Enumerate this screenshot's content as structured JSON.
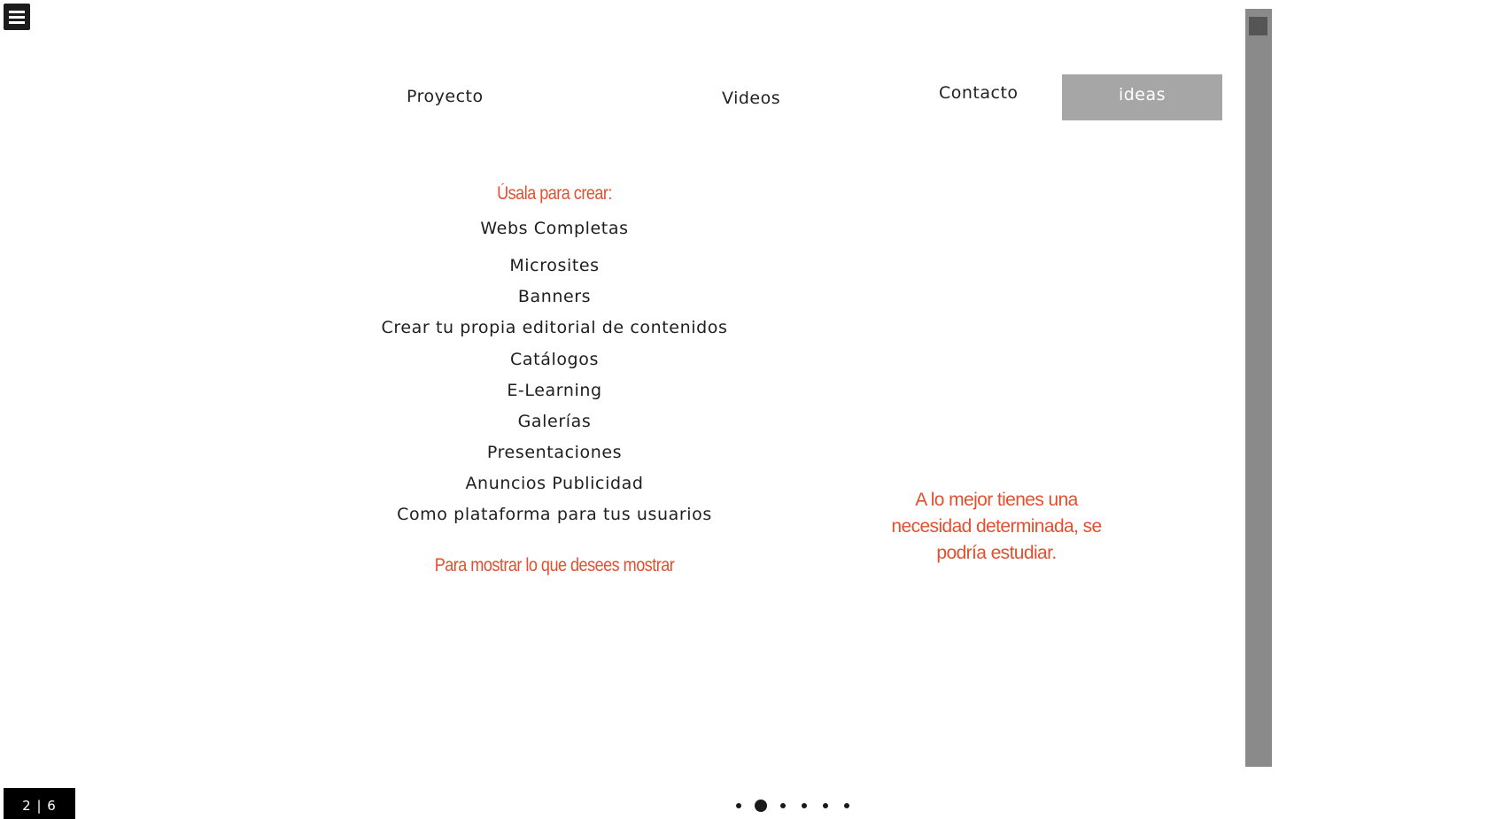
{
  "nav": {
    "proyecto": "Proyecto",
    "videos": "Videos",
    "contacto": "Contacto",
    "ideas": "ideas"
  },
  "list": {
    "heading": "Úsala para crear:",
    "items": [
      "Webs Completas",
      "Microsites",
      "Banners",
      "Crear tu propia editorial de contenidos",
      "Catálogos",
      "E-Learning",
      "Galerías",
      "Presentaciones",
      "Anuncios Publicidad",
      "Como plataforma para tus usuarios"
    ],
    "footer": "Para mostrar lo que desees mostrar"
  },
  "side_note": "A lo mejor tienes una necesidad determinada, se podría estudiar.",
  "pager": {
    "counter": "2 | 6",
    "total_pages": 6,
    "current_page": 2
  },
  "colors": {
    "accent_red": "#e2502f",
    "nav_active_bg": "#a6a6a6",
    "scroll_track": "#8a8a8a"
  }
}
